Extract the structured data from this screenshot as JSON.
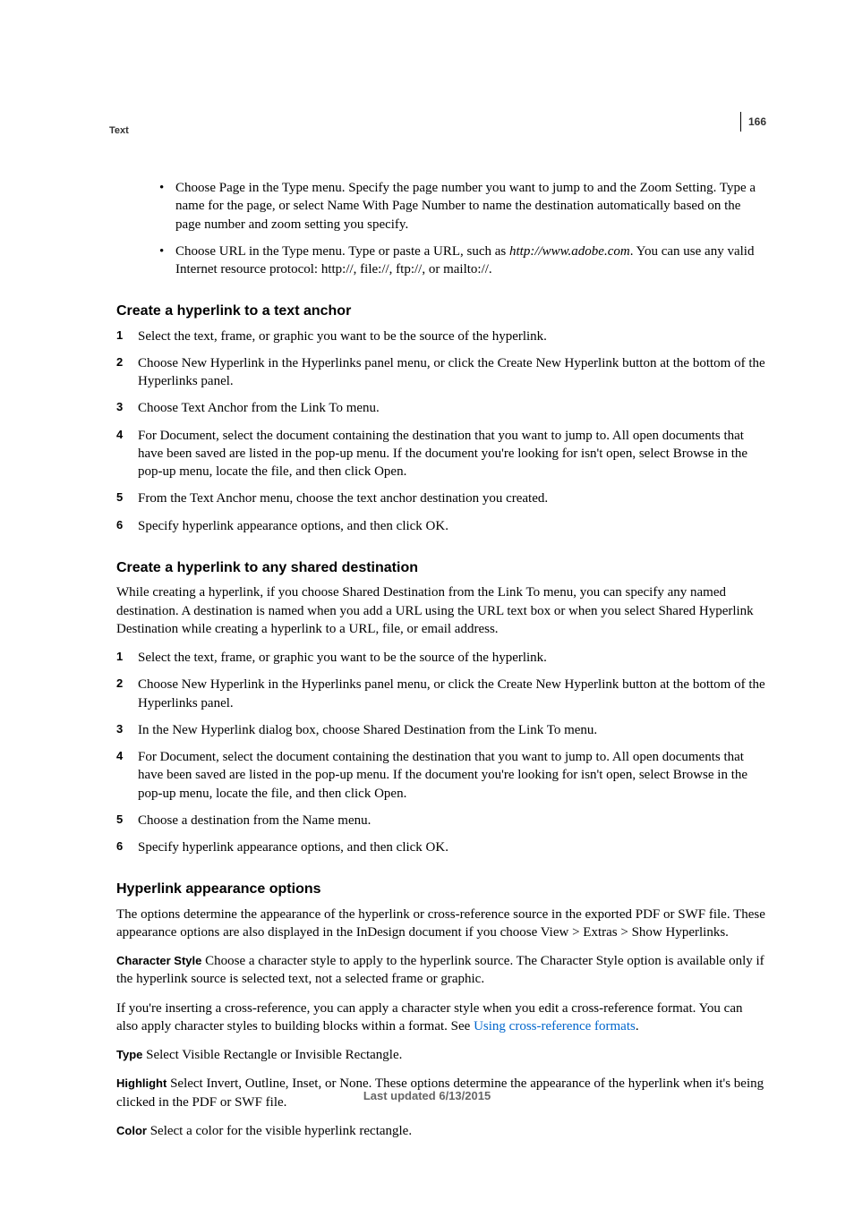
{
  "header": {
    "section": "Text",
    "page_number": "166"
  },
  "bullets": {
    "b1_pre": "Choose Page in the Type menu. Specify the page number you want to jump to and the Zoom Setting. Type a name for the page, or select Name With Page Number to name the destination automatically based on the page number and zoom setting you specify.",
    "b2_pre": "Choose URL in the Type menu. Type or paste a URL, such as ",
    "b2_url": "http://www.adobe.com",
    "b2_post": ". You can use any valid Internet resource protocol: http://, file://, ftp://, or mailto://."
  },
  "section1": {
    "title": "Create a hyperlink to a text anchor",
    "steps": {
      "s1": "Select the text, frame, or graphic you want to be the source of the hyperlink.",
      "s2": "Choose New Hyperlink in the Hyperlinks panel menu, or click the Create New Hyperlink button at the bottom of the Hyperlinks panel.",
      "s3": "Choose Text Anchor from the Link To menu.",
      "s4": "For Document, select the document containing the destination that you want to jump to. All open documents that have been saved are listed in the pop-up menu. If the document you're looking for isn't open, select Browse in the pop-up menu, locate the file, and then click Open.",
      "s5": "From the Text Anchor menu, choose the text anchor destination you created.",
      "s6": "Specify hyperlink appearance options, and then click OK."
    }
  },
  "section2": {
    "title": "Create a hyperlink to any shared destination",
    "intro": "While creating a hyperlink, if you choose Shared Destination from the Link To menu, you can specify any named destination. A destination is named when you add a URL using the URL text box or when you select Shared Hyperlink Destination while creating a hyperlink to a URL, file, or email address.",
    "steps": {
      "s1": "Select the text, frame, or graphic you want to be the source of the hyperlink.",
      "s2": "Choose New Hyperlink in the Hyperlinks panel menu, or click the Create New Hyperlink button at the bottom of the Hyperlinks panel.",
      "s3": "In the New Hyperlink dialog box, choose Shared Destination from the Link To menu.",
      "s4": "For Document, select the document containing the destination that you want to jump to. All open documents that have been saved are listed in the pop-up menu. If the document you're looking for isn't open, select Browse in the pop-up menu, locate the file, and then click Open.",
      "s5": "Choose a destination from the Name menu.",
      "s6": "Specify hyperlink appearance options, and then click OK."
    }
  },
  "section3": {
    "title": "Hyperlink appearance options",
    "intro": "The options determine the appearance of the hyperlink or cross-reference source in the exported PDF or SWF file. These appearance options are also displayed in the InDesign document if you choose View > Extras > Show Hyperlinks.",
    "char_style_label": "Character Style",
    "char_style_text": " Choose a character style to apply to the hyperlink source. The Character Style option is available only if the hyperlink source is selected text, not a selected frame or graphic.",
    "para3_pre": "If you're inserting a cross-reference, you can apply a character style when you edit a cross-reference format. You can also apply character styles to building blocks within a format. See ",
    "para3_link": "Using cross-reference formats",
    "para3_post": ".",
    "type_label": "Type",
    "type_text": " Select Visible Rectangle or Invisible Rectangle.",
    "highlight_label": "Highlight",
    "highlight_text": " Select Invert, Outline, Inset, or None. These options determine the appearance of the hyperlink when it's being clicked in the PDF or SWF file.",
    "color_label": "Color",
    "color_text": " Select a color for the visible hyperlink rectangle."
  },
  "footer": "Last updated 6/13/2015"
}
